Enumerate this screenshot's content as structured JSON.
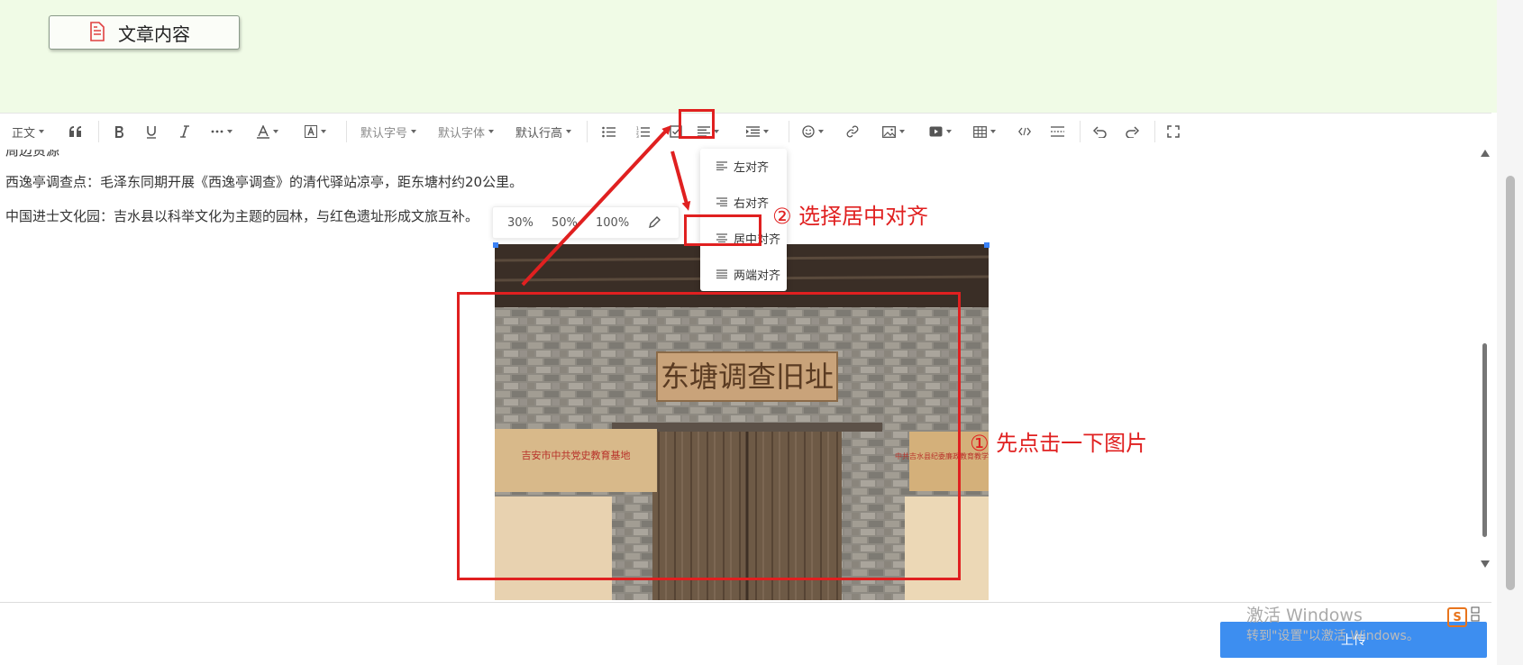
{
  "tab": {
    "label": "文章内容"
  },
  "toolbar": {
    "paragraph_format": "正文",
    "font_size": "默认字号",
    "font_family": "默认字体",
    "line_height": "默认行高"
  },
  "content": {
    "line_partial": "周边资源",
    "line1": "西逸亭调查点：毛泽东同期开展《西逸亭调查》的清代驿站凉亭，距东塘村约20公里。",
    "line2": "中国进士文化园：吉水县以科举文化为主题的园林，与红色遗址形成文旅互补。"
  },
  "image_toolbar": {
    "opt1": "30%",
    "opt2": "50%",
    "opt3": "100%"
  },
  "align_menu": {
    "items": [
      {
        "label": "左对齐"
      },
      {
        "label": "右对齐"
      },
      {
        "label": "居中对齐"
      },
      {
        "label": "两端对齐"
      }
    ]
  },
  "image": {
    "sign_text": "东塘调查旧址",
    "left_plaque": "吉安市中共党史教育基地",
    "right_plaque": "中共吉水县纪委廉政教育教学基地"
  },
  "annotations": {
    "step1": "① 先点击一下图片",
    "step2": "② 选择居中对齐"
  },
  "footer": {
    "watermark_title": "激活 Windows",
    "watermark_sub": "转到\"设置\"以激活 Windows。",
    "upload_label": "上传"
  },
  "colors": {
    "annotation_red": "#e02020",
    "upload_blue": "#3d8ef0",
    "top_bg": "#f0fbe6"
  }
}
